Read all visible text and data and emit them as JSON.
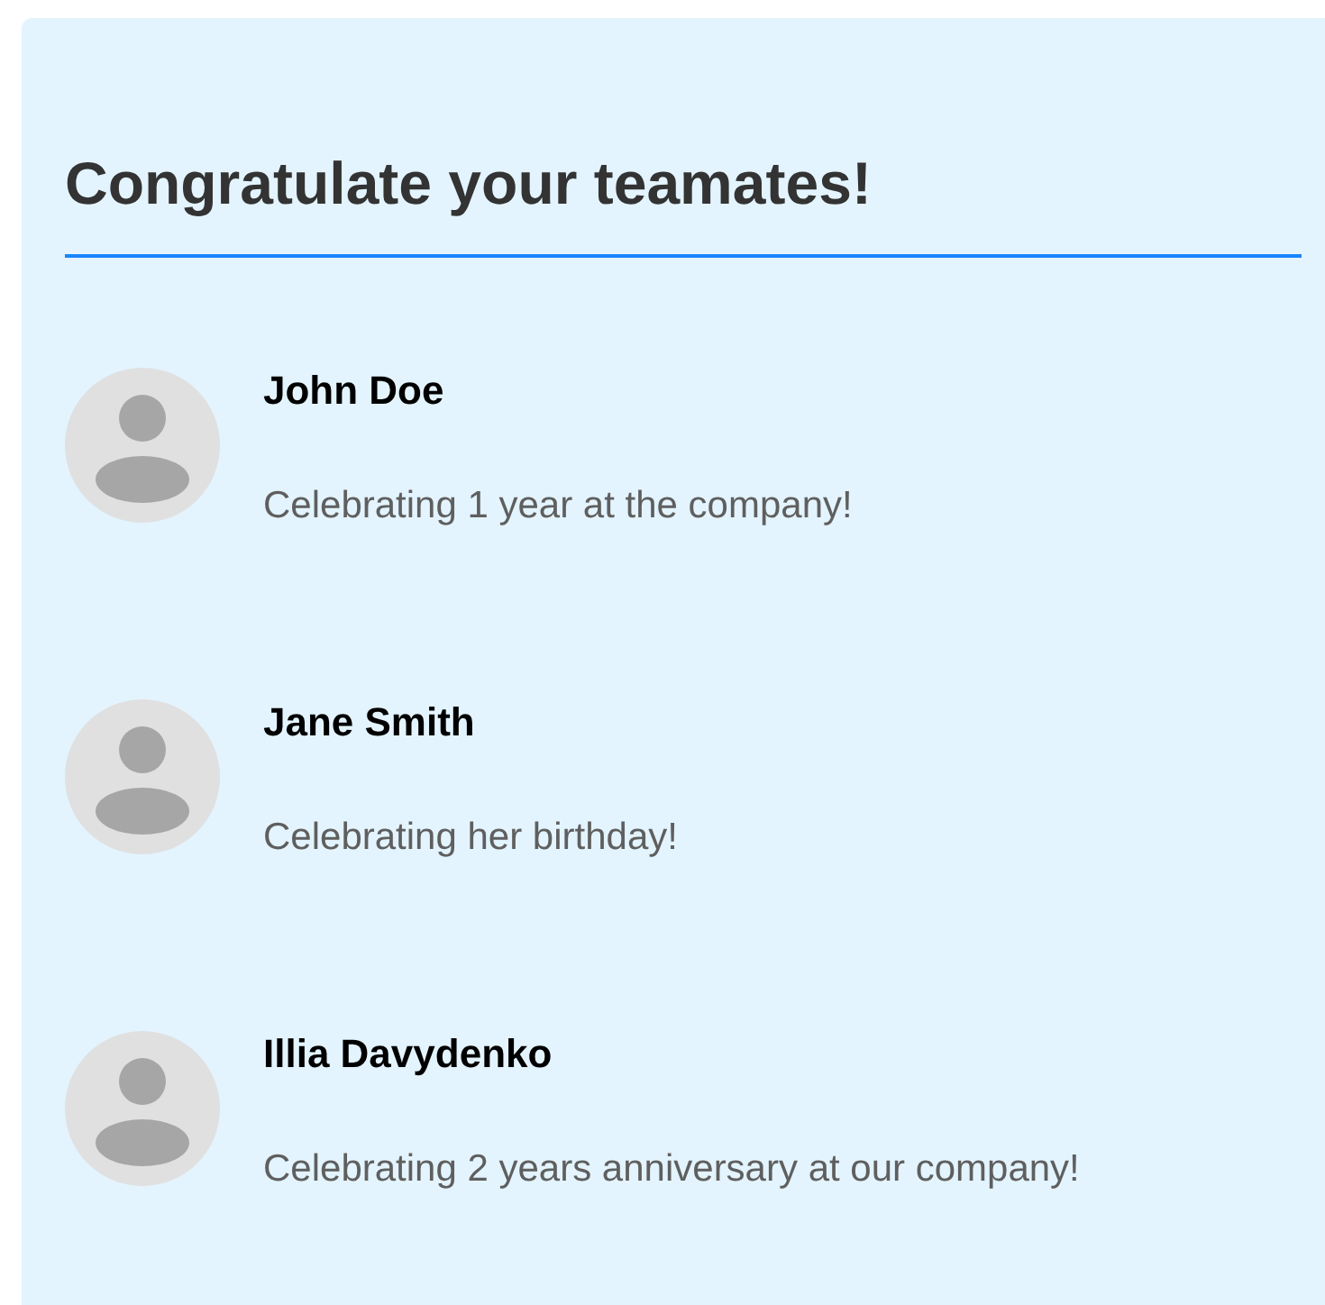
{
  "heading": "Congratulate your teamates!",
  "people": [
    {
      "name": "John Doe",
      "message": "Celebrating 1 year at the company!"
    },
    {
      "name": "Jane Smith",
      "message": "Celebrating her birthday!"
    },
    {
      "name": "Illia Davydenko",
      "message": "Celebrating 2 years anniversary at our company!"
    }
  ]
}
